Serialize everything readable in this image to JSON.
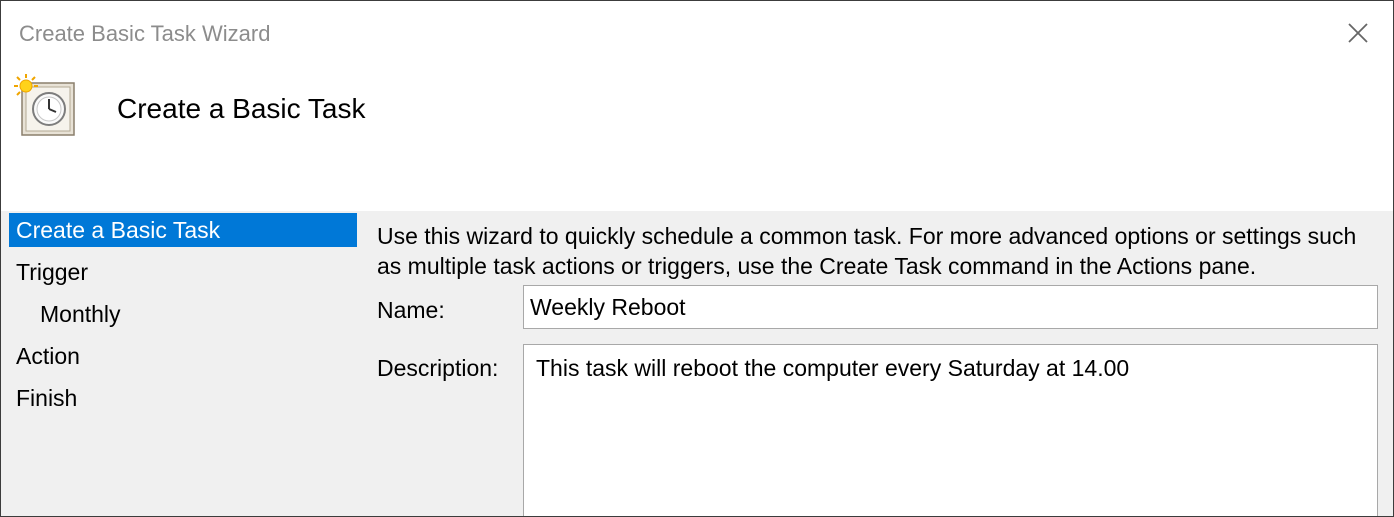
{
  "window": {
    "title": "Create Basic Task Wizard",
    "close_icon": "close-icon"
  },
  "header": {
    "title": "Create a Basic Task",
    "icon": "scheduled-task-clock-icon"
  },
  "nav": {
    "items": [
      {
        "label": "Create a Basic Task",
        "selected": true
      },
      {
        "label": "Trigger"
      },
      {
        "label": "Monthly",
        "indent": true
      },
      {
        "label": "Action"
      },
      {
        "label": "Finish"
      }
    ]
  },
  "main": {
    "intro": "Use this wizard to quickly schedule a common task.  For more advanced options or settings such as multiple task actions or triggers, use the Create Task command in the Actions pane.",
    "name_label": "Name:",
    "name_value": "Weekly Reboot",
    "description_label": "Description:",
    "description_value": "This task will reboot the computer every Saturday at 14.00"
  },
  "colors": {
    "accent": "#0078d7",
    "panel_bg": "#f0f0f0",
    "title_gray": "#8c8c8c"
  }
}
